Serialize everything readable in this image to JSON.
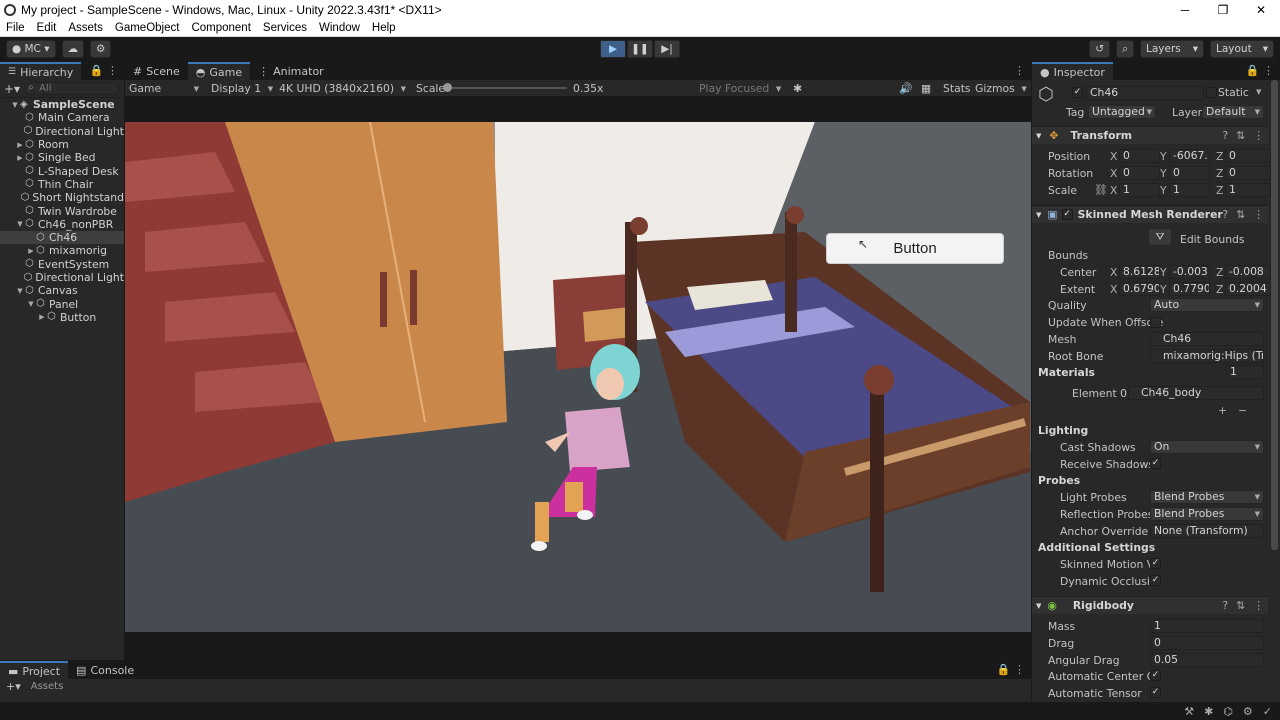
{
  "window": {
    "title": "My project - SampleScene - Windows, Mac, Linux - Unity 2022.3.43f1* <DX11>",
    "minimize": "─",
    "maximize": "❐",
    "close": "✕"
  },
  "menu": [
    "File",
    "Edit",
    "Assets",
    "GameObject",
    "Component",
    "Services",
    "Window",
    "Help"
  ],
  "toolbar": {
    "account": "MC",
    "layers": "Layers",
    "layout": "Layout"
  },
  "hierarchy": {
    "tab": "Hierarchy",
    "search_placeholder": "All",
    "items": [
      {
        "label": "SampleScene",
        "depth": 0
      },
      {
        "label": "Main Camera",
        "depth": 1
      },
      {
        "label": "Directional Light",
        "depth": 1
      },
      {
        "label": "Room",
        "depth": 1
      },
      {
        "label": "Single Bed",
        "depth": 1
      },
      {
        "label": "L-Shaped Desk",
        "depth": 1
      },
      {
        "label": "Thin Chair",
        "depth": 1
      },
      {
        "label": "Short Nightstand",
        "depth": 1
      },
      {
        "label": "Twin Wardrobe",
        "depth": 1
      },
      {
        "label": "Ch46_nonPBR",
        "depth": 1
      },
      {
        "label": "Ch46",
        "depth": 2
      },
      {
        "label": "mixamorig",
        "depth": 2
      },
      {
        "label": "EventSystem",
        "depth": 1
      },
      {
        "label": "Directional Light",
        "depth": 1
      },
      {
        "label": "Canvas",
        "depth": 1
      },
      {
        "label": "Panel",
        "depth": 2
      },
      {
        "label": "Button",
        "depth": 3
      }
    ]
  },
  "game_view": {
    "tabs": [
      "Scene",
      "Game",
      "Animator"
    ],
    "mode": "Game",
    "display": "Display 1",
    "resolution": "4K UHD (3840x2160)",
    "scale_label": "Scale",
    "scale_value": "0.35x",
    "play_focused": "Play Focused",
    "stats": "Stats",
    "gizmos": "Gizmos",
    "ui_button_label": "Button"
  },
  "inspector": {
    "tab": "Inspector",
    "object_name": "Ch46",
    "static_label": "Static",
    "tag_label": "Tag",
    "tag_value": "Untagged",
    "layer_label": "Layer",
    "layer_value": "Default",
    "transform": {
      "title": "Transform",
      "position_label": "Position",
      "position": [
        "0",
        "-6067.",
        "0"
      ],
      "rotation_label": "Rotation",
      "rotation": [
        "0",
        "0",
        "0"
      ],
      "scale_label": "Scale",
      "scale": [
        "1",
        "1",
        "1"
      ]
    },
    "smr": {
      "title": "Skinned Mesh Renderer",
      "edit_bounds": "Edit Bounds",
      "bounds_label": "Bounds",
      "center_label": "Center",
      "center": [
        "8.6128",
        "-0.003",
        "-0.008"
      ],
      "extent_label": "Extent",
      "extent": [
        "0.6790",
        "0.7790",
        "0.2004"
      ],
      "quality_label": "Quality",
      "quality": "Auto",
      "update_offscreen_label": "Update When Offscre",
      "mesh_label": "Mesh",
      "mesh": "Ch46",
      "root_bone_label": "Root Bone",
      "root_bone": "mixamorig:Hips (Tr",
      "materials_label": "Materials",
      "materials_count": "1",
      "element0_label": "Element 0",
      "element0": "Ch46_body",
      "lighting_label": "Lighting",
      "cast_shadows_label": "Cast Shadows",
      "cast_shadows": "On",
      "receive_shadows_label": "Receive Shadows",
      "probes_label": "Probes",
      "light_probes_label": "Light Probes",
      "light_probes": "Blend Probes",
      "reflection_probes_label": "Reflection Probes",
      "reflection_probes": "Blend Probes",
      "anchor_override_label": "Anchor Override",
      "anchor_override": "None (Transform)",
      "additional_label": "Additional Settings",
      "skinned_motion_label": "Skinned Motion Ve",
      "dynamic_occlusion_label": "Dynamic Occlusic"
    },
    "rigidbody": {
      "title": "Rigidbody",
      "mass_label": "Mass",
      "mass": "1",
      "drag_label": "Drag",
      "drag": "0",
      "angular_drag_label": "Angular Drag",
      "angular_drag": "0.05",
      "auto_center_label": "Automatic Center Of",
      "auto_tensor_label": "Automatic Tensor"
    }
  },
  "bottom": {
    "tabs": [
      "Project",
      "Console"
    ],
    "assets_label": "Assets"
  }
}
